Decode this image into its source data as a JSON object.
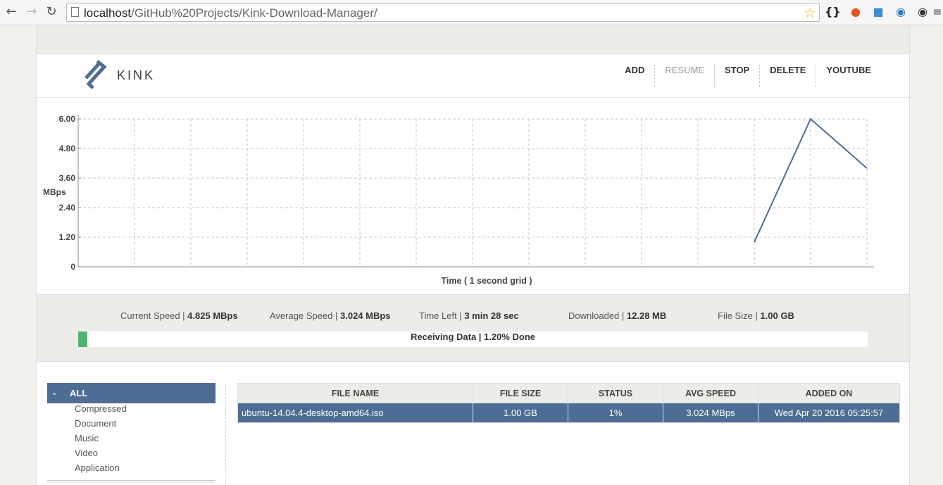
{
  "browser": {
    "url_host": "localhost",
    "url_path": "/GitHub%20Projects/Kink-Download-Manager/"
  },
  "app": {
    "logo_text": "KINK",
    "menu": [
      {
        "label": "ADD",
        "enabled": true
      },
      {
        "label": "RESUME",
        "enabled": false
      },
      {
        "label": "STOP",
        "enabled": true
      },
      {
        "label": "DELETE",
        "enabled": true
      },
      {
        "label": "YOUTUBE",
        "enabled": true
      }
    ]
  },
  "chart_data": {
    "type": "line",
    "xlabel": "Time ( 1 second grid )",
    "ylabel": "MBps",
    "y_ticks": [
      "0",
      "1.20",
      "2.40",
      "3.60",
      "4.80",
      "6.00"
    ],
    "ylim": [
      0,
      6
    ],
    "x_grid_count": 14,
    "grid": true,
    "series": [
      {
        "x": [
          12,
          13,
          14
        ],
        "values": [
          1.0,
          6.0,
          4.0
        ]
      }
    ],
    "line_color": "#4d6d94"
  },
  "stats": {
    "current_speed_label": "Current Speed",
    "current_speed": "4.825 MBps",
    "average_speed_label": "Average Speed",
    "average_speed": "3.024 MBps",
    "time_left_label": "Time Left",
    "time_left": "3 min 28 sec",
    "downloaded_label": "Downloaded",
    "downloaded": "12.28 MB",
    "file_size_label": "File Size",
    "file_size": "1.00 GB"
  },
  "progress": {
    "text": "Receiving Data | 1.20% Done",
    "percent": 1.2
  },
  "sidebar": {
    "all": {
      "toggle": "-",
      "label": "ALL"
    },
    "items": [
      "Compressed",
      "Document",
      "Music",
      "Video",
      "Application"
    ]
  },
  "table": {
    "headers": [
      "FILE NAME",
      "FILE SIZE",
      "STATUS",
      "AVG SPEED",
      "ADDED ON"
    ],
    "rows": [
      [
        "ubuntu-14.04.4-desktop-amd64.iso",
        "1.00 GB",
        "1%",
        "3.024 MBps",
        "Wed Apr 20 2016 05:25:57"
      ]
    ]
  },
  "colors": {
    "accent": "#4d6d94",
    "progress_fill": "#4cb66d",
    "band": "#ecece8"
  }
}
